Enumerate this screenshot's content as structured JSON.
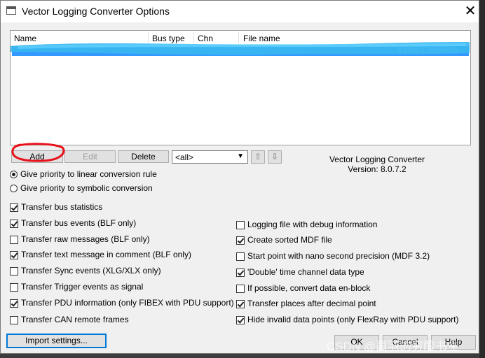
{
  "window": {
    "title": "Vector Logging Converter Options",
    "close_glyph": "✕"
  },
  "list": {
    "columns": [
      "Name",
      "Bus type",
      "Chn",
      "File name"
    ],
    "selected_row_tail": "A CAN 2 20250000"
  },
  "list_buttons": {
    "add": "Add",
    "edit": "Edit",
    "delete": "Delete"
  },
  "filter": {
    "selected": "<all>",
    "up_icon": "arrow-up",
    "down_icon": "arrow-down"
  },
  "about": {
    "name": "Vector Logging Converter",
    "version": "Version: 8.0.7.2"
  },
  "conversion_rule": {
    "options": [
      {
        "label": "Give priority to linear conversion rule",
        "selected": true
      },
      {
        "label": "Give priority to symbolic conversion",
        "selected": false
      }
    ]
  },
  "left_options": [
    {
      "label": "Transfer bus statistics",
      "checked": true
    },
    {
      "label": "Transfer bus events (BLF only)",
      "checked": true
    },
    {
      "label": "Transfer raw messages (BLF only)",
      "checked": false
    },
    {
      "label": "Transfer text message in comment (BLF only)",
      "checked": true
    },
    {
      "label": "Transfer Sync events (XLG/XLX only)",
      "checked": false
    },
    {
      "label": "Transfer Trigger events as signal",
      "checked": false
    },
    {
      "label": "Transfer PDU information (only FIBEX with PDU support)",
      "checked": true
    },
    {
      "label": "Transfer CAN remote frames",
      "checked": false
    }
  ],
  "right_options": [
    {
      "label": "Logging file with debug information",
      "checked": false
    },
    {
      "label": "Create sorted MDF file",
      "checked": true
    },
    {
      "label": "Start point with nano second precision (MDF 3.2)",
      "checked": false
    },
    {
      "label": "'Double' time channel data type",
      "checked": true
    },
    {
      "label": "If possible, convert data en-block",
      "checked": false
    },
    {
      "label": "Transfer places after decimal point",
      "checked": true
    },
    {
      "label": "Hide invalid data points (only FlexRay with PDU support)",
      "checked": true
    }
  ],
  "footer": {
    "import": "Import settings...",
    "ok": "OK",
    "cancel": "Cancel",
    "help": "Help"
  },
  "watermark": "CSDN @赢羽的穷酸书生",
  "colors": {
    "selection": "#3399ff",
    "scribble": "#39b7f0",
    "annotation_ring": "#e8121b",
    "focus": "#0078d7"
  }
}
